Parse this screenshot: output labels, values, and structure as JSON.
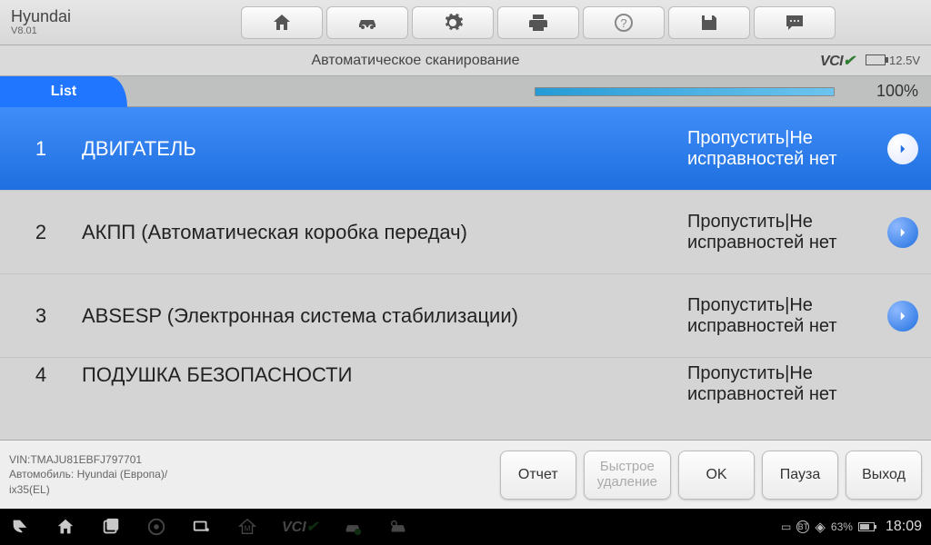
{
  "header": {
    "brand": "Hyundai",
    "version": "V8.01"
  },
  "subheader": {
    "title": "Автоматическое сканирование",
    "voltage": "12.5V"
  },
  "progress": {
    "tab": "List",
    "percent": "100%"
  },
  "list": [
    {
      "index": "1",
      "system": "ДВИГАТЕЛЬ",
      "status": "Пропустить|Не исправностей нет"
    },
    {
      "index": "2",
      "system": "АКПП (Автоматическая коробка передач)",
      "status": "Пропустить|Не исправностей нет"
    },
    {
      "index": "3",
      "system": "ABSESP (Электронная система стабилизации)",
      "status": "Пропустить|Не исправностей нет"
    },
    {
      "index": "4",
      "system": "ПОДУШКА БЕЗОПАСНОСТИ",
      "status": "Пропустить|Не исправностей нет"
    }
  ],
  "footer": {
    "vin": "VIN:TMAJU81EBFJ797701",
    "vehicle": "Автомобиль: Hyundai (Европа)/",
    "model": "ix35(EL)",
    "buttons": [
      "Отчет",
      "Быстрое\nудаление",
      "OK",
      "Пауза",
      "Выход"
    ]
  },
  "navbar": {
    "battery": "63%",
    "time": "18:09"
  }
}
